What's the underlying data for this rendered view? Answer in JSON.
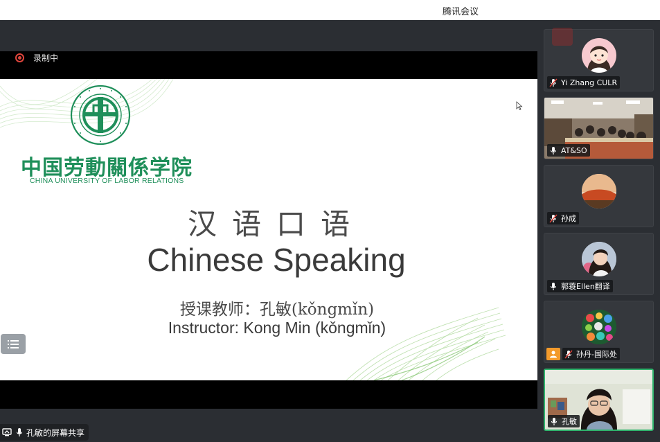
{
  "window": {
    "title": "腾讯会议"
  },
  "recording": {
    "label": "录制中",
    "color": "#e0453c"
  },
  "slide": {
    "logo_cn": "中国劳動關係学院",
    "logo_en": "CHINA UNIVERSITY OF LABOR RELATIONS",
    "title_cn": "汉语口语",
    "title_en": "Chinese Speaking",
    "instructor_cn": "授课教师：孔敏(kǒngmǐn)",
    "instructor_en": "Instructor: Kong Min (kǒngmǐn)",
    "brand_color": "#1f8f5a"
  },
  "share_bar": {
    "label": "孔敏的屏幕共享"
  },
  "participants": [
    {
      "name": "Yi Zhang CULR",
      "mic": "muted",
      "avatar": "cartoon-girl-avatar"
    },
    {
      "name": "AT&SO",
      "mic": "on",
      "avatar": "classroom-video"
    },
    {
      "name": "孙成",
      "mic": "muted",
      "avatar": "rock-landscape-avatar"
    },
    {
      "name": "郭蓑Ellen翻译",
      "mic": "on",
      "avatar": "woman-photo-avatar"
    },
    {
      "name": "孙丹-国际处",
      "mic": "muted",
      "avatar": "colorful-stones-avatar",
      "host": true
    },
    {
      "name": "孔敏",
      "mic": "on",
      "avatar": "speaker-video",
      "active": true
    }
  ],
  "colors": {
    "active_speaker": "#2fb36c",
    "host_badge": "#f39a2b",
    "background": "#2b2e33"
  }
}
